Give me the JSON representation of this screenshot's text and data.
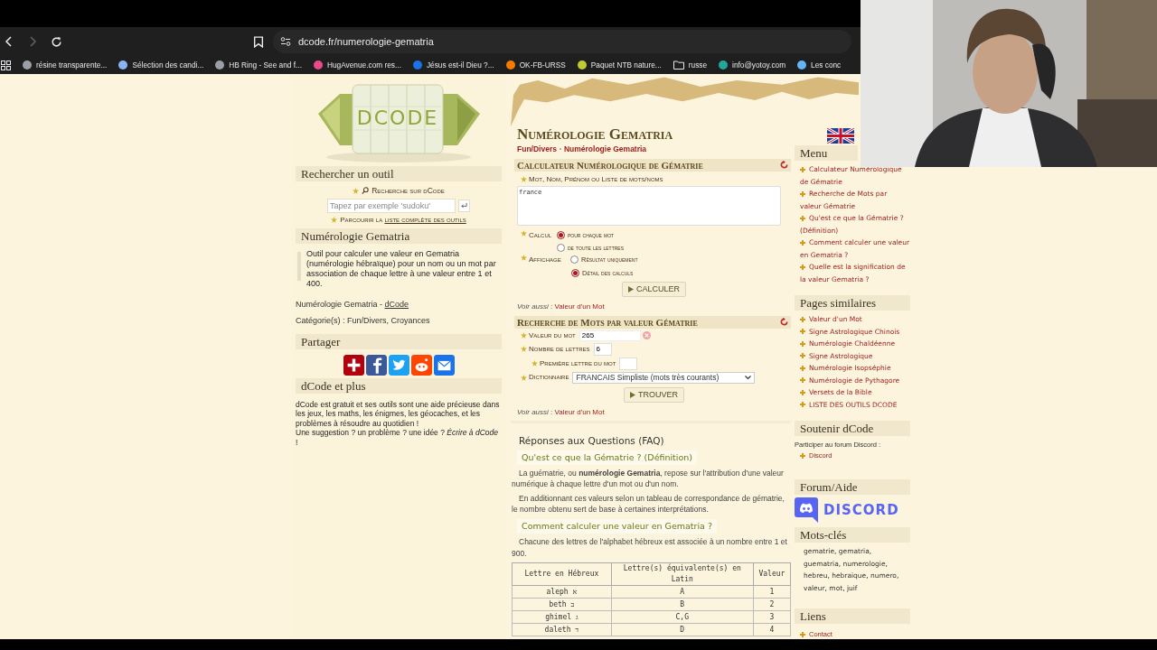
{
  "browser": {
    "nav": [
      {
        "kind": "back",
        "disabled": false
      },
      {
        "kind": "forward",
        "disabled": true
      },
      {
        "kind": "reload",
        "disabled": false
      }
    ],
    "url": "dcode.fr/numerologie-gematria",
    "bookmarks": [
      {
        "kind": "site",
        "label": "résine transparente...",
        "color": "#9aa0a6"
      },
      {
        "kind": "site",
        "label": "Sélection des candi...",
        "color": "#8ab4f8"
      },
      {
        "kind": "site",
        "label": "HB Ring - See and f...",
        "color": "#9aa0a6"
      },
      {
        "kind": "site",
        "label": "HugAvenue.com res...",
        "color": "#e94b8a"
      },
      {
        "kind": "site",
        "label": "Jésus est-il Dieu ?...",
        "color": "#1a73e8"
      },
      {
        "kind": "site",
        "label": "OK-FB-URSS",
        "color": "#f57c00"
      },
      {
        "kind": "site",
        "label": "Paquet NTB nature...",
        "color": "#c0ca33"
      },
      {
        "kind": "folder",
        "label": "russe"
      },
      {
        "kind": "site",
        "label": "info@yotoy.com",
        "color": "#26a69a"
      },
      {
        "kind": "site",
        "label": "Les conc",
        "color": "#64b5f6"
      }
    ]
  },
  "logo": {
    "text": "DCODE"
  },
  "left": {
    "search": {
      "title": "Rechercher un outil",
      "label": "Recherche sur dCode",
      "placeholder": "Tapez par exemple 'sudoku'",
      "browse_prefix": "Parcourir la ",
      "browse_link": "liste complète des outils"
    },
    "tool": {
      "title": "Numérologie Gematria",
      "description": "Outil pour calculer une valeur en Gematria (numérologie hébraïque) pour un nom ou un mot par association de chaque lettre à une valeur entre 1 et 400.",
      "credit_prefix": "Numérologie Gematria - ",
      "credit_link": "dCode",
      "category": "Catégorie(s) : Fun/Divers, Croyances"
    },
    "share": {
      "title": "Partager",
      "buttons": [
        {
          "kind": "plus"
        },
        {
          "kind": "facebook"
        },
        {
          "kind": "twitter"
        },
        {
          "kind": "reddit"
        },
        {
          "kind": "email"
        }
      ]
    },
    "more": {
      "title": "dCode et plus",
      "text": "dCode est gratuit et ses outils sont une aide précieuse dans les jeux, les maths, les énigmes, les géocaches, et les problèmes à résoudre au quotidien !",
      "suggestion": "Une suggestion ? un problème ? une idée ? *Écrire à dCode* !"
    }
  },
  "main": {
    "title": "Numérologie Gematria",
    "breadcrumb": [
      "Fun/Divers",
      "Numérologie Gematria"
    ],
    "calculator": {
      "title": "Calculateur Numérologique de Gématrie",
      "field_label": "Mot, Nom, Prénom ou Liste de mots/noms",
      "value": "france",
      "groups": [
        {
          "label": "Calcul",
          "options": [
            {
              "label": "pour chaque mot",
              "selected": true
            },
            {
              "label": "de toute les lettres",
              "selected": false
            }
          ]
        },
        {
          "label": "Affichage",
          "options": [
            {
              "label": "Résultat uniquement",
              "selected": false
            },
            {
              "label": "Détail des calculs",
              "selected": true
            }
          ]
        }
      ],
      "button": "CALCULER",
      "see_also": "*Voir aussi* :",
      "see_also_link": "Valeur d'un Mot"
    },
    "search": {
      "title": "Recherche de Mots par valeur Gématrie",
      "value_label": "Valeur du mot",
      "value": "265",
      "letters_label": "Nombre de lettres",
      "letters": "6",
      "first_label": "Première lettre du mot",
      "dict_label": "Dictionnaire",
      "dict": "FRANCAIS Simpliste (mots très courants)",
      "button": "TROUVER",
      "see_also": "*Voir aussi* :",
      "see_also_link": "Valeur d'un Mot"
    },
    "faq": {
      "title": "Réponses aux Questions (FAQ)",
      "sections": [
        {
          "question": "Qu'est ce que la Gématrie ? (Définition)",
          "paragraphs": [
            "La guématrie, ou **numérologie Gematria**, repose sur l'attribution d'une valeur numérique à chaque lettre d'un mot ou d'un nom.",
            "En additionnant ces valeurs selon un tableau de correspondance de gématrie, le nombre obtenu sert de base à certaines interprétations."
          ]
        },
        {
          "question": "Comment calculer une valeur en Gematria ?",
          "paragraphs": [
            "Chacune des lettres de l'alphabet hébreux est associée à un nombre entre 1 et 900."
          ]
        }
      ]
    },
    "table": {
      "columns": [
        "Lettre en Hébreux",
        "Lettre(s) équivalente(s) en Latin",
        "Valeur"
      ],
      "rows": [
        [
          "aleph א",
          "A",
          "1"
        ],
        [
          "beth ב",
          "B",
          "2"
        ],
        [
          "ghimel ג",
          "C,G",
          "3"
        ],
        [
          "daleth ד",
          "D",
          "4"
        ]
      ]
    }
  },
  "right": {
    "menu": {
      "title": "Menu",
      "items": [
        "Calculateur Numérologique de Gématrie",
        "Recherche de Mots par valeur Gématrie",
        "Qu'est ce que la Gématrie ? (Définition)",
        "Comment calculer une valeur en Gematria ?",
        "Quelle est la signification de la valeur Gematria ?"
      ]
    },
    "similar": {
      "title": "Pages similaires",
      "items": [
        "Valeur d'un Mot",
        "Signe Astrologique Chinois",
        "Numérologie Chaldéenne",
        "Signe Astrologique",
        "Numérologie Isopséphie",
        "Numérologie de Pythagore",
        "Versets de la Bible",
        "LISTE DES OUTILS DCODE"
      ]
    },
    "support": {
      "title": "Soutenir dCode",
      "text": "Participer au forum Discord :",
      "items": [
        "Discord"
      ]
    },
    "forum": {
      "title": "Forum/Aide",
      "logo_text": "DISCORD"
    },
    "keywords": {
      "title": "Mots-clés",
      "text": "gematrie, gematria, guematria, numerologie, hebreu, hebraique, numero, valeur, mot, juif"
    },
    "links": {
      "title": "Liens",
      "items": [
        "Contact"
      ]
    }
  }
}
